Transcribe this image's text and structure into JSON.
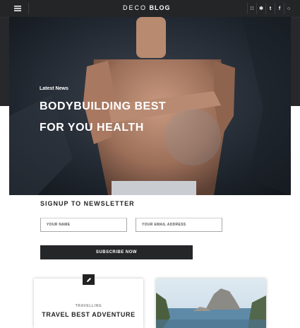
{
  "header": {
    "logo_part1": "DECO",
    "logo_part2": "BLOG",
    "menu_icon": "hamburger-menu-icon",
    "social_icons": [
      "rss-icon",
      "twitter-icon",
      "tumblr-icon",
      "facebook-icon",
      "search-icon"
    ],
    "social_glyphs": [
      "∷",
      "❄",
      "t",
      "f",
      "○"
    ]
  },
  "hero": {
    "category": "Latest News",
    "title_line1": "BODYBUILDING BEST",
    "title_line2": "FOR YOU HEALTH"
  },
  "newsletter": {
    "title": "SIGNUP TO NEWSLETTER",
    "name_placeholder": "YOUR NAME",
    "email_placeholder": "YOUR EMAIL ADDRESS",
    "subscribe_label": "SUBSCRIBE NOW"
  },
  "cards": [
    {
      "category": "TRAVELLING",
      "title": "TRAVEL BEST ADVENTURE",
      "badge_icon": "pencil-icon"
    },
    {
      "image": "island-landscape-image"
    }
  ],
  "colors": {
    "dark_band": "#26282b",
    "topbar": "#232527",
    "button": "#252628",
    "text": "#222222"
  }
}
